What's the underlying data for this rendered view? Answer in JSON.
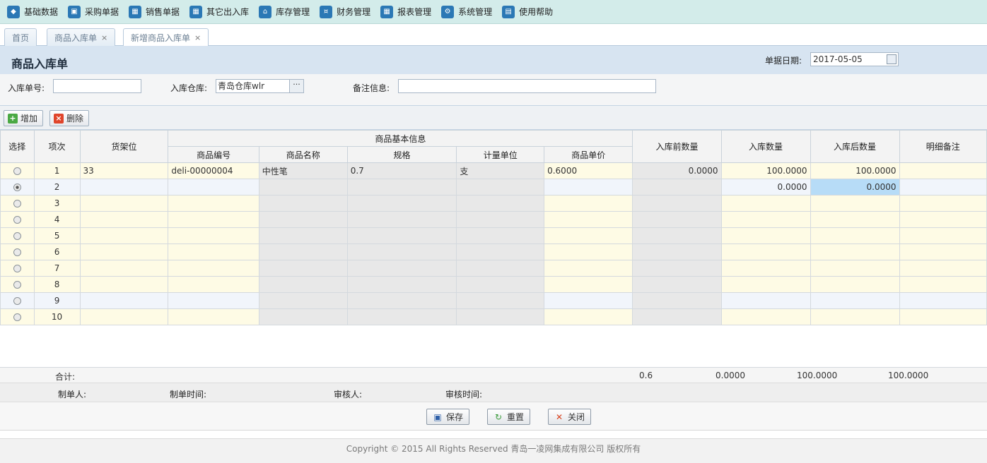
{
  "nav": [
    {
      "label": "基础数据",
      "icon": "cube-icon",
      "glyph": "◆"
    },
    {
      "label": "采购单据",
      "icon": "basket-icon",
      "glyph": "▣"
    },
    {
      "label": "销售单据",
      "icon": "calendar-icon",
      "glyph": "▦"
    },
    {
      "label": "其它出入库",
      "icon": "calendar-icon",
      "glyph": "▦"
    },
    {
      "label": "库存管理",
      "icon": "home-icon",
      "glyph": "⌂"
    },
    {
      "label": "财务管理",
      "icon": "money-icon",
      "glyph": "¤"
    },
    {
      "label": "报表管理",
      "icon": "calendar-icon",
      "glyph": "▦"
    },
    {
      "label": "系统管理",
      "icon": "gear-icon",
      "glyph": "⚙"
    },
    {
      "label": "使用帮助",
      "icon": "book-icon",
      "glyph": "▤"
    }
  ],
  "tabs": [
    {
      "label": "首页"
    },
    {
      "label": "商品入库单",
      "close": "×"
    },
    {
      "label": "新增商品入库单",
      "close": "×"
    }
  ],
  "header": {
    "title": "商品入库单",
    "date_label": "单据日期:",
    "date_value": "2017-05-05"
  },
  "form": {
    "order_no_label": "入库单号:",
    "order_no_value": "",
    "warehouse_label": "入库仓库:",
    "warehouse_value": "青岛仓库wlr",
    "warehouse_button": "···",
    "remark_label": "备注信息:",
    "remark_value": ""
  },
  "toolbar": {
    "add_label": "增加",
    "delete_label": "删除"
  },
  "table": {
    "group_header": "商品基本信息",
    "headers": {
      "select": "选择",
      "index": "项次",
      "shelf": "货架位",
      "code": "商品编号",
      "name": "商品名称",
      "spec": "规格",
      "unit": "计量单位",
      "price": "商品单价",
      "before_qty": "入库前数量",
      "in_qty": "入库数量",
      "after_qty": "入库后数量",
      "remark": "明细备注"
    },
    "rows": [
      {
        "index": "1",
        "shelf": "33",
        "code": "deli-00000004",
        "name": "中性笔",
        "spec": "0.7",
        "unit": "支",
        "price": "0.6000",
        "before_qty": "0.0000",
        "in_qty": "100.0000",
        "after_qty": "100.0000",
        "remark": "",
        "selected": false
      },
      {
        "index": "2",
        "shelf": "",
        "code": "",
        "name": "",
        "spec": "",
        "unit": "",
        "price": "",
        "before_qty": "",
        "in_qty": "0.0000",
        "after_qty": "0.0000",
        "remark": "",
        "selected": true
      },
      {
        "index": "3",
        "shelf": "",
        "code": "",
        "name": "",
        "spec": "",
        "unit": "",
        "price": "",
        "before_qty": "",
        "in_qty": "",
        "after_qty": "",
        "remark": "",
        "selected": false
      },
      {
        "index": "4",
        "shelf": "",
        "code": "",
        "name": "",
        "spec": "",
        "unit": "",
        "price": "",
        "before_qty": "",
        "in_qty": "",
        "after_qty": "",
        "remark": "",
        "selected": false
      },
      {
        "index": "5",
        "shelf": "",
        "code": "",
        "name": "",
        "spec": "",
        "unit": "",
        "price": "",
        "before_qty": "",
        "in_qty": "",
        "after_qty": "",
        "remark": "",
        "selected": false
      },
      {
        "index": "6",
        "shelf": "",
        "code": "",
        "name": "",
        "spec": "",
        "unit": "",
        "price": "",
        "before_qty": "",
        "in_qty": "",
        "after_qty": "",
        "remark": "",
        "selected": false
      },
      {
        "index": "7",
        "shelf": "",
        "code": "",
        "name": "",
        "spec": "",
        "unit": "",
        "price": "",
        "before_qty": "",
        "in_qty": "",
        "after_qty": "",
        "remark": "",
        "selected": false
      },
      {
        "index": "8",
        "shelf": "",
        "code": "",
        "name": "",
        "spec": "",
        "unit": "",
        "price": "",
        "before_qty": "",
        "in_qty": "",
        "after_qty": "",
        "remark": "",
        "selected": false
      },
      {
        "index": "9",
        "shelf": "",
        "code": "",
        "name": "",
        "spec": "",
        "unit": "",
        "price": "",
        "before_qty": "",
        "in_qty": "",
        "after_qty": "",
        "remark": "",
        "selected": false
      },
      {
        "index": "10",
        "shelf": "",
        "code": "",
        "name": "",
        "spec": "",
        "unit": "",
        "price": "",
        "before_qty": "",
        "in_qty": "",
        "after_qty": "",
        "remark": "",
        "selected": false
      }
    ]
  },
  "summary": {
    "label": "合计:",
    "price_total": "0.6",
    "before_total": "0.0000",
    "in_total": "100.0000",
    "after_total": "100.0000"
  },
  "meta": {
    "creator_label": "制单人:",
    "create_time_label": "制单时间:",
    "auditor_label": "审核人:",
    "audit_time_label": "审核时间:"
  },
  "actions": {
    "save_label": "保存",
    "reset_label": "重置",
    "close_label": "关闭"
  },
  "footer": {
    "text": "Copyright © 2015 All Rights Reserved 青岛一凌网集成有限公司 版权所有"
  },
  "colors": {
    "nav_bg": "#d3ecea",
    "title_bg": "#d7e4f1",
    "row_yellow": "#fefbe5",
    "row_selected_cell": "#b7dcf7",
    "icon_blue": "#2b78b5"
  }
}
